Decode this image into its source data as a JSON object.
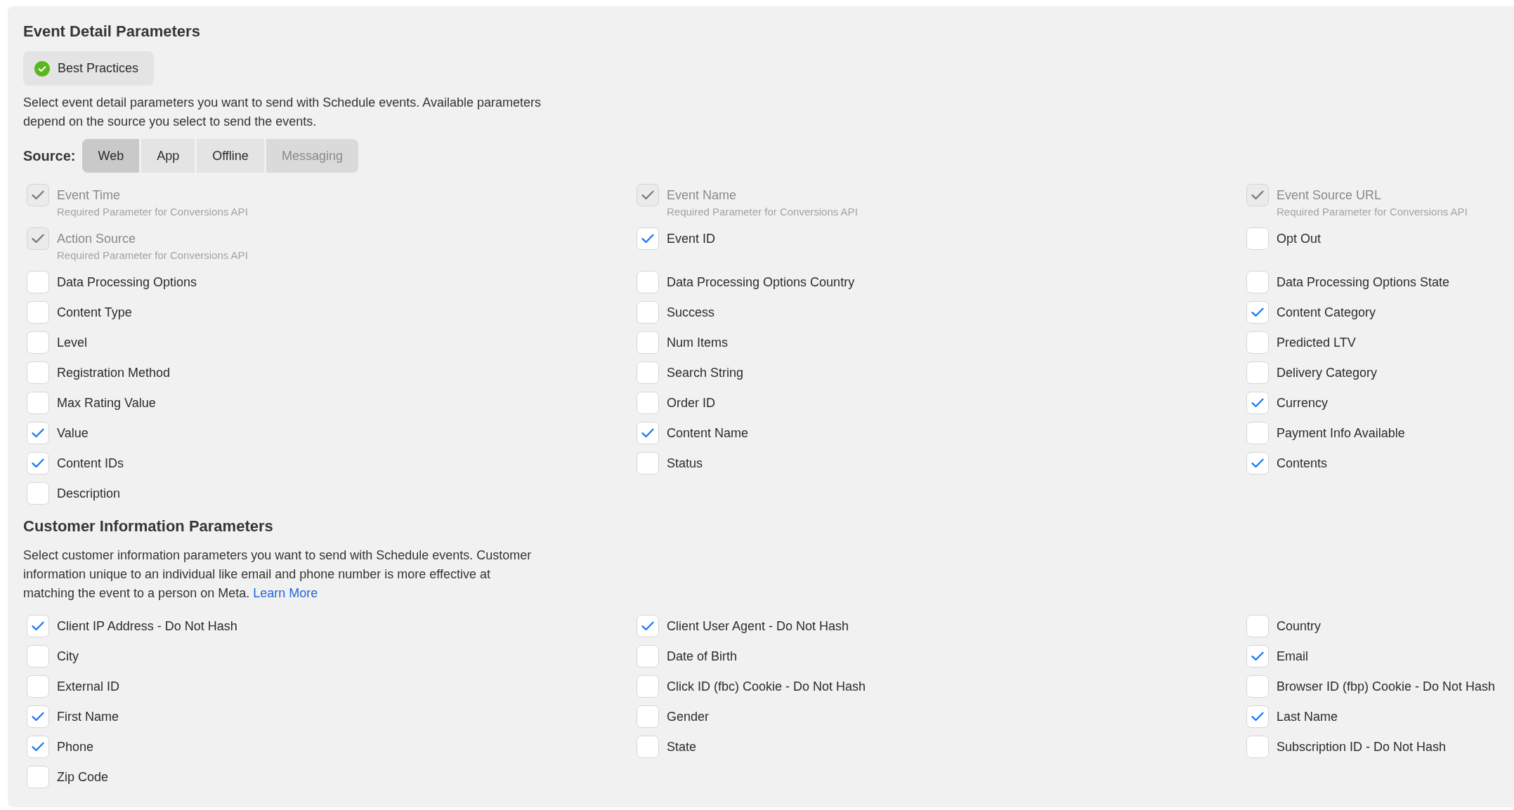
{
  "sections": [
    {
      "title": "Event Detail Parameters",
      "best_practices": {
        "label": "Best Practices"
      },
      "description": "Select event detail parameters you want to send with Schedule events. Available parameters depend on the source you select to send the events.",
      "source": {
        "label": "Source:",
        "tabs": [
          {
            "label": "Web",
            "selected": true,
            "disabled": false
          },
          {
            "label": "App",
            "selected": false,
            "disabled": false
          },
          {
            "label": "Offline",
            "selected": false,
            "disabled": false
          },
          {
            "label": "Messaging",
            "selected": false,
            "disabled": true
          }
        ]
      },
      "parameters": [
        {
          "label": "Event Time",
          "note": "Required Parameter for Conversions API",
          "checked": true,
          "disabled": true
        },
        {
          "label": "Event Name",
          "note": "Required Parameter for Conversions API",
          "checked": true,
          "disabled": true
        },
        {
          "label": "Event Source URL",
          "note": "Required Parameter for Conversions API",
          "checked": true,
          "disabled": true
        },
        {
          "label": "Action Source",
          "note": "Required Parameter for Conversions API",
          "checked": true,
          "disabled": true
        },
        {
          "label": "Event ID",
          "checked": true,
          "disabled": false
        },
        {
          "label": "Opt Out",
          "checked": false,
          "disabled": false
        },
        {
          "label": "Data Processing Options",
          "checked": false,
          "disabled": false
        },
        {
          "label": "Data Processing Options Country",
          "checked": false,
          "disabled": false
        },
        {
          "label": "Data Processing Options State",
          "checked": false,
          "disabled": false
        },
        {
          "label": "Content Type",
          "checked": false,
          "disabled": false
        },
        {
          "label": "Success",
          "checked": false,
          "disabled": false
        },
        {
          "label": "Content Category",
          "checked": true,
          "disabled": false
        },
        {
          "label": "Level",
          "checked": false,
          "disabled": false
        },
        {
          "label": "Num Items",
          "checked": false,
          "disabled": false
        },
        {
          "label": "Predicted LTV",
          "checked": false,
          "disabled": false
        },
        {
          "label": "Registration Method",
          "checked": false,
          "disabled": false
        },
        {
          "label": "Search String",
          "checked": false,
          "disabled": false
        },
        {
          "label": "Delivery Category",
          "checked": false,
          "disabled": false
        },
        {
          "label": "Max Rating Value",
          "checked": false,
          "disabled": false
        },
        {
          "label": "Order ID",
          "checked": false,
          "disabled": false
        },
        {
          "label": "Currency",
          "checked": true,
          "disabled": false
        },
        {
          "label": "Value",
          "checked": true,
          "disabled": false
        },
        {
          "label": "Content Name",
          "checked": true,
          "disabled": false
        },
        {
          "label": "Payment Info Available",
          "checked": false,
          "disabled": false
        },
        {
          "label": "Content IDs",
          "checked": true,
          "disabled": false
        },
        {
          "label": "Status",
          "checked": false,
          "disabled": false
        },
        {
          "label": "Contents",
          "checked": true,
          "disabled": false
        },
        {
          "label": "Description",
          "checked": false,
          "disabled": false
        }
      ]
    },
    {
      "title": "Customer Information Parameters",
      "description": "Select customer information parameters you want to send with Schedule events. Customer information unique to an individual like email and phone number is more effective at matching the event to a person on Meta.",
      "link": "Learn More",
      "parameters": [
        {
          "label": "Client IP Address - Do Not Hash",
          "checked": true,
          "disabled": false
        },
        {
          "label": "Client User Agent - Do Not Hash",
          "checked": true,
          "disabled": false
        },
        {
          "label": "Country",
          "checked": false,
          "disabled": false
        },
        {
          "label": "City",
          "checked": false,
          "disabled": false
        },
        {
          "label": "Date of Birth",
          "checked": false,
          "disabled": false
        },
        {
          "label": "Email",
          "checked": true,
          "disabled": false
        },
        {
          "label": "External ID",
          "checked": false,
          "disabled": false
        },
        {
          "label": "Click ID (fbc) Cookie - Do Not Hash",
          "checked": false,
          "disabled": false
        },
        {
          "label": "Browser ID (fbp) Cookie - Do Not Hash",
          "checked": false,
          "disabled": false
        },
        {
          "label": "First Name",
          "checked": true,
          "disabled": false
        },
        {
          "label": "Gender",
          "checked": false,
          "disabled": false
        },
        {
          "label": "Last Name",
          "checked": true,
          "disabled": false
        },
        {
          "label": "Phone",
          "checked": true,
          "disabled": false
        },
        {
          "label": "State",
          "checked": false,
          "disabled": false
        },
        {
          "label": "Subscription ID - Do Not Hash",
          "checked": false,
          "disabled": false
        },
        {
          "label": "Zip Code",
          "checked": false,
          "disabled": false
        }
      ]
    }
  ]
}
